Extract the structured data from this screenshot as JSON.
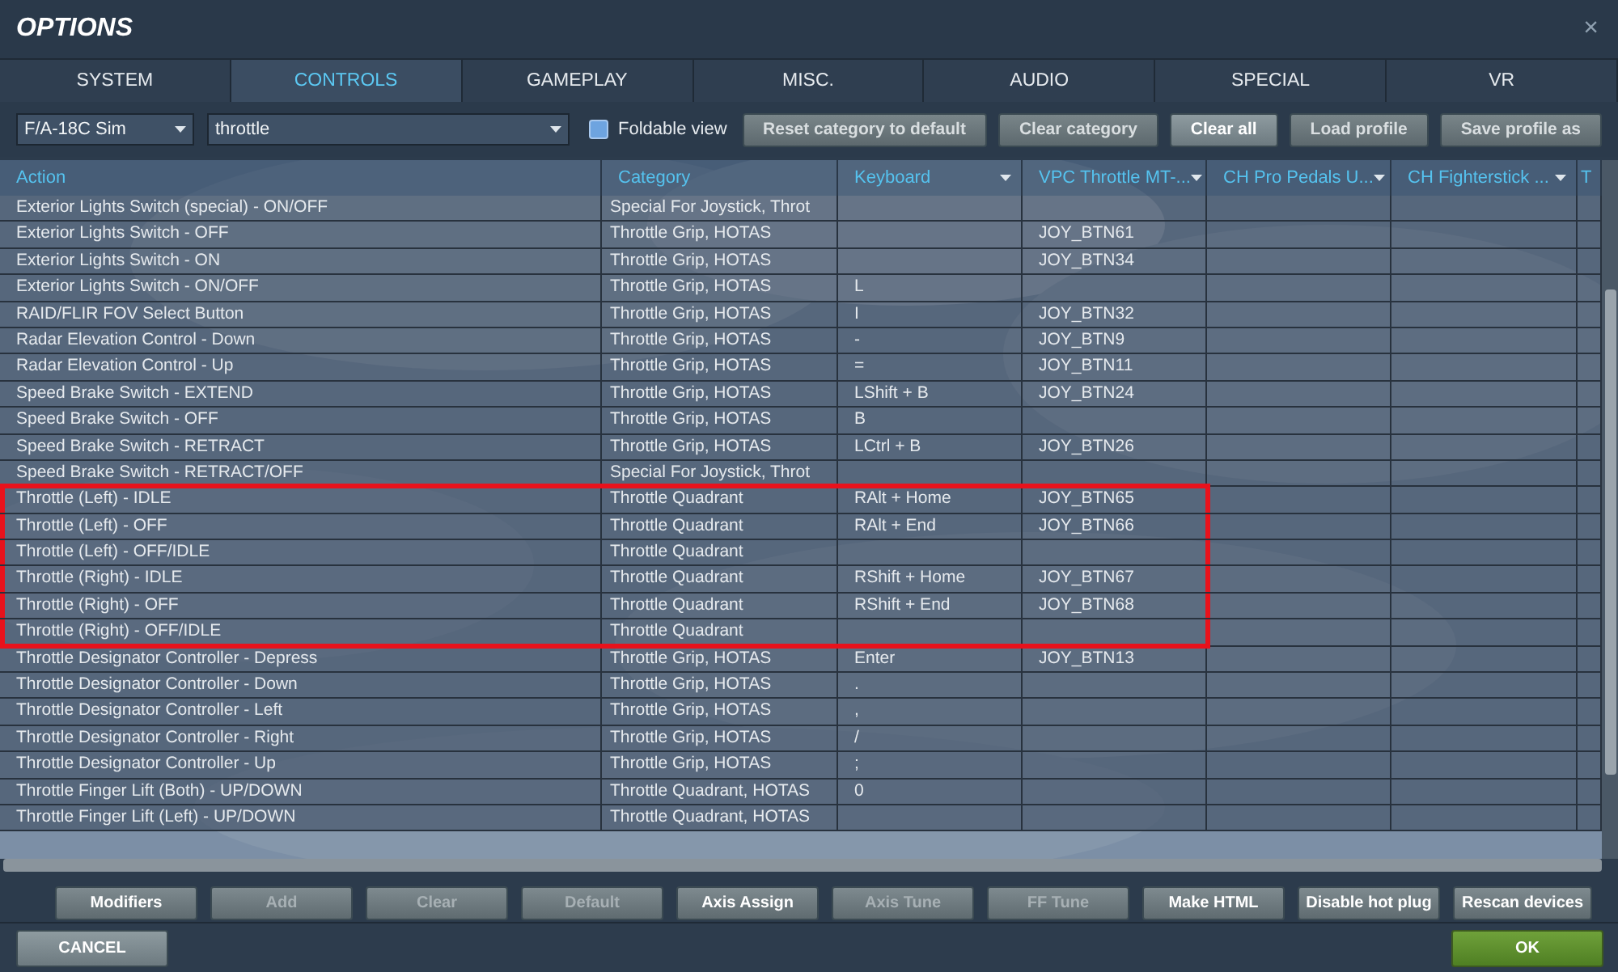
{
  "window": {
    "title": "OPTIONS",
    "close": "×"
  },
  "tabs": [
    {
      "label": "SYSTEM",
      "selected": false
    },
    {
      "label": "CONTROLS",
      "selected": true
    },
    {
      "label": "GAMEPLAY",
      "selected": false
    },
    {
      "label": "MISC.",
      "selected": false
    },
    {
      "label": "AUDIO",
      "selected": false
    },
    {
      "label": "SPECIAL",
      "selected": false
    },
    {
      "label": "VR",
      "selected": false
    }
  ],
  "toolbar": {
    "aircraft_select": "F/A-18C Sim",
    "search": {
      "value": "throttle"
    },
    "foldable_view": {
      "label": "Foldable view",
      "checked": false
    },
    "buttons": [
      {
        "label": "Reset category to default",
        "active": false
      },
      {
        "label": "Clear category",
        "active": false
      },
      {
        "label": "Clear all",
        "active": true
      },
      {
        "label": "Load profile",
        "active": false
      },
      {
        "label": "Save profile as",
        "active": false
      }
    ]
  },
  "table": {
    "columns": [
      {
        "label": "Action",
        "has_menu": false
      },
      {
        "label": "Category",
        "has_menu": false
      },
      {
        "label": "Keyboard",
        "has_menu": true
      },
      {
        "label": "VPC Throttle MT-...",
        "has_menu": true
      },
      {
        "label": "CH Pro Pedals U...",
        "has_menu": true
      },
      {
        "label": "CH Fighterstick ...",
        "has_menu": true
      },
      {
        "label": "T",
        "has_menu": false
      }
    ],
    "rows": [
      {
        "action": "Exterior Lights Switch (special) - ON/OFF",
        "category": "Special For Joystick, Throt",
        "highlighted": false
      },
      {
        "action": "Exterior Lights Switch - OFF",
        "category": "Throttle Grip, HOTAS",
        "vpc": "JOY_BTN61",
        "highlighted": false
      },
      {
        "action": "Exterior Lights Switch - ON",
        "category": "Throttle Grip, HOTAS",
        "vpc": "JOY_BTN34",
        "highlighted": false
      },
      {
        "action": "Exterior Lights Switch - ON/OFF",
        "category": "Throttle Grip, HOTAS",
        "keyboard": "L",
        "highlighted": false
      },
      {
        "action": "RAID/FLIR FOV Select Button",
        "category": "Throttle Grip, HOTAS",
        "keyboard": "I",
        "vpc": "JOY_BTN32",
        "highlighted": false
      },
      {
        "action": "Radar Elevation Control - Down",
        "category": "Throttle Grip, HOTAS",
        "keyboard": "-",
        "vpc": "JOY_BTN9",
        "highlighted": false
      },
      {
        "action": "Radar Elevation Control - Up",
        "category": "Throttle Grip, HOTAS",
        "keyboard": "=",
        "vpc": "JOY_BTN11",
        "highlighted": false
      },
      {
        "action": "Speed Brake Switch - EXTEND",
        "category": "Throttle Grip, HOTAS",
        "keyboard": "LShift + B",
        "vpc": "JOY_BTN24",
        "highlighted": false
      },
      {
        "action": "Speed Brake Switch - OFF",
        "category": "Throttle Grip, HOTAS",
        "keyboard": "B",
        "highlighted": false
      },
      {
        "action": "Speed Brake Switch - RETRACT",
        "category": "Throttle Grip, HOTAS",
        "keyboard": "LCtrl + B",
        "vpc": "JOY_BTN26",
        "highlighted": false
      },
      {
        "action": "Speed Brake Switch - RETRACT/OFF",
        "category": "Special For Joystick, Throt",
        "highlighted": false
      },
      {
        "action": "Throttle (Left) - IDLE",
        "category": "Throttle Quadrant",
        "keyboard": "RAlt + Home",
        "vpc": "JOY_BTN65",
        "highlighted": true
      },
      {
        "action": "Throttle (Left) - OFF",
        "category": "Throttle Quadrant",
        "keyboard": "RAlt + End",
        "vpc": "JOY_BTN66",
        "highlighted": true
      },
      {
        "action": "Throttle (Left) - OFF/IDLE",
        "category": "Throttle Quadrant",
        "highlighted": true
      },
      {
        "action": "Throttle (Right) - IDLE",
        "category": "Throttle Quadrant",
        "keyboard": "RShift + Home",
        "vpc": "JOY_BTN67",
        "highlighted": true
      },
      {
        "action": "Throttle (Right) - OFF",
        "category": "Throttle Quadrant",
        "keyboard": "RShift + End",
        "vpc": "JOY_BTN68",
        "highlighted": true
      },
      {
        "action": "Throttle (Right) - OFF/IDLE",
        "category": "Throttle Quadrant",
        "highlighted": true
      },
      {
        "action": "Throttle Designator Controller - Depress",
        "category": "Throttle Grip, HOTAS",
        "keyboard": "Enter",
        "vpc": "JOY_BTN13",
        "highlighted": false
      },
      {
        "action": "Throttle Designator Controller - Down",
        "category": "Throttle Grip, HOTAS",
        "keyboard": ".",
        "highlighted": false
      },
      {
        "action": "Throttle Designator Controller - Left",
        "category": "Throttle Grip, HOTAS",
        "keyboard": ",",
        "highlighted": false
      },
      {
        "action": "Throttle Designator Controller - Right",
        "category": "Throttle Grip, HOTAS",
        "keyboard": "/",
        "highlighted": false
      },
      {
        "action": "Throttle Designator Controller - Up",
        "category": "Throttle Grip, HOTAS",
        "keyboard": ";",
        "highlighted": false
      },
      {
        "action": "Throttle Finger Lift (Both) - UP/DOWN",
        "category": "Throttle Quadrant, HOTAS",
        "keyboard": "0",
        "highlighted": false
      },
      {
        "action": "Throttle Finger Lift (Left) - UP/DOWN",
        "category": "Throttle Quadrant, HOTAS",
        "highlighted": false
      }
    ]
  },
  "action_buttons": [
    {
      "label": "Modifiers",
      "disabled": false
    },
    {
      "label": "Add",
      "disabled": true
    },
    {
      "label": "Clear",
      "disabled": true
    },
    {
      "label": "Default",
      "disabled": true
    },
    {
      "label": "Axis Assign",
      "disabled": false
    },
    {
      "label": "Axis Tune",
      "disabled": true
    },
    {
      "label": "FF Tune",
      "disabled": true
    },
    {
      "label": "Make HTML",
      "disabled": false
    },
    {
      "label": "Disable hot plug",
      "disabled": false
    },
    {
      "label": "Rescan devices",
      "disabled": false
    }
  ],
  "footer": {
    "cancel": "CANCEL",
    "ok": "OK"
  }
}
